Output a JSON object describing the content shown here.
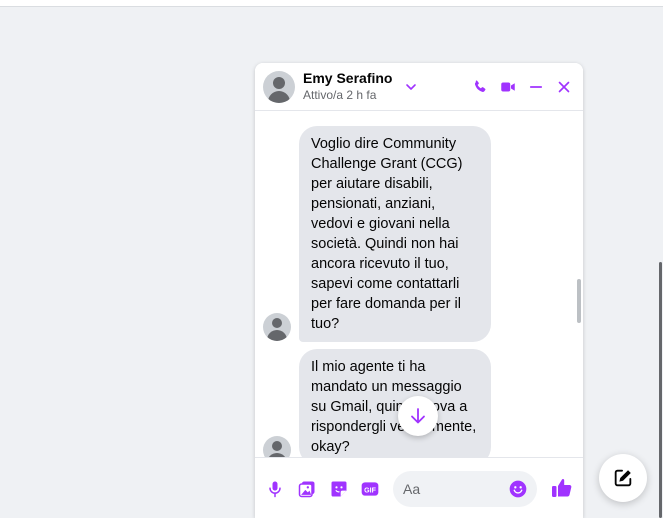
{
  "chat": {
    "contact_name": "Emy Serafino",
    "contact_status": "Attivo/a 2 h fa",
    "accent_color": "#a033ff",
    "header_icons": [
      "chevron-down-icon",
      "phone-icon",
      "video-icon",
      "minimize-icon",
      "close-icon"
    ]
  },
  "messages": [
    {
      "text": "Voglio dire Community Challenge Grant (CCG) per aiutare disabili, pensionati, anziani, vedovi e giovani nella società. Quindi non hai ancora ricevuto il tuo, sapevi come contattarli per fare domanda per il tuo?"
    },
    {
      "text": "Il mio agente ti ha mandato un messaggio su Gmail, quindi prova a rispondergli velocemente, okay?"
    }
  ],
  "composer": {
    "placeholder": "Aa",
    "icons": [
      "microphone-icon",
      "image-icon",
      "sticker-icon",
      "gif-icon",
      "emoji-icon",
      "thumbs-up-icon"
    ],
    "gif_label": "GIF"
  }
}
